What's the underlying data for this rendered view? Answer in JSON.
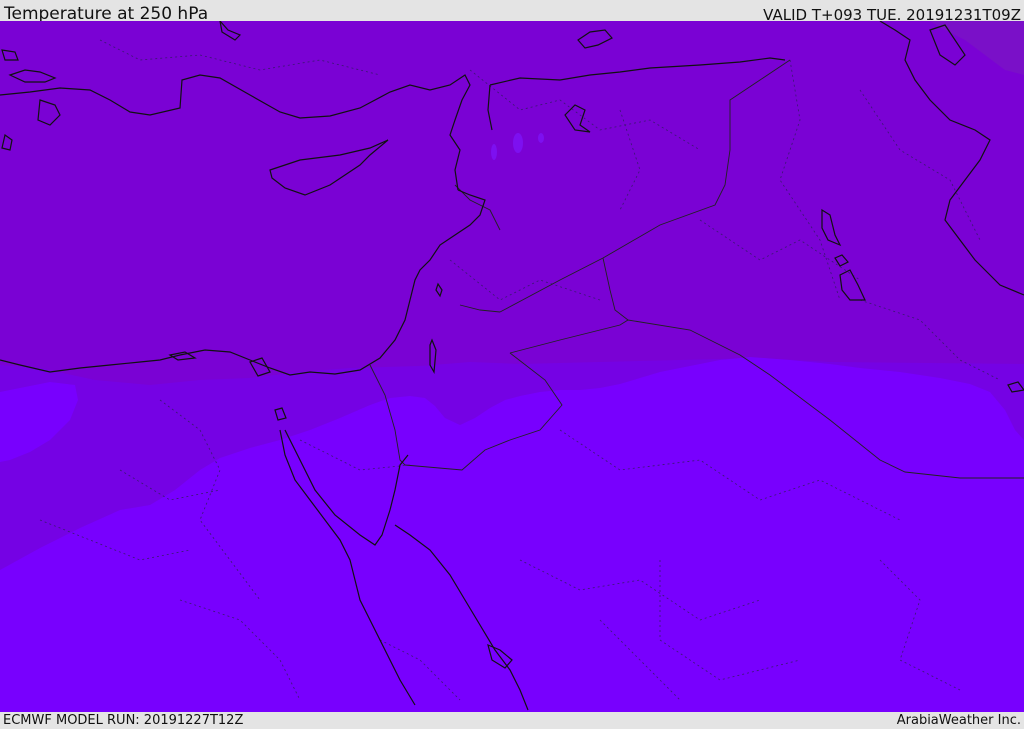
{
  "header": {
    "title": "Temperature at 250 hPa",
    "valid_time": "VALID T+093 TUE. 20191231T09Z"
  },
  "footer": {
    "model_run": "ECMWF MODEL RUN: 20191227T12Z",
    "credit": "ArabiaWeather Inc."
  },
  "map": {
    "colors": {
      "band_warm": "#7a02d4",
      "band_mid": "#7502e4",
      "band_cold": "#7800fe",
      "coast_line": "#111111",
      "border_line": "#222222",
      "internal_border": "#3a1870"
    }
  }
}
